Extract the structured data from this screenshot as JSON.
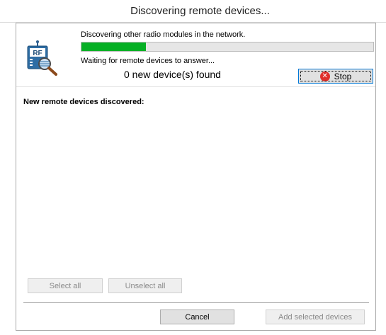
{
  "window": {
    "title": "Discovering remote devices..."
  },
  "status": {
    "discovering_message": "Discovering other radio modules in the network.",
    "waiting_message": "Waiting for remote devices to answer...",
    "found_text": "0 new device(s) found",
    "progress": 0.22,
    "progress_color": "#06b025"
  },
  "icon": {
    "name": "rf-module-search-icon",
    "text": "RF"
  },
  "buttons": {
    "stop_label": "Stop",
    "stop_icon": "close-circle-icon",
    "select_all_label": "Select all",
    "unselect_all_label": "Unselect all",
    "cancel_label": "Cancel",
    "add_selected_label": "Add selected devices"
  },
  "list": {
    "header": "New remote devices discovered:",
    "items": []
  }
}
